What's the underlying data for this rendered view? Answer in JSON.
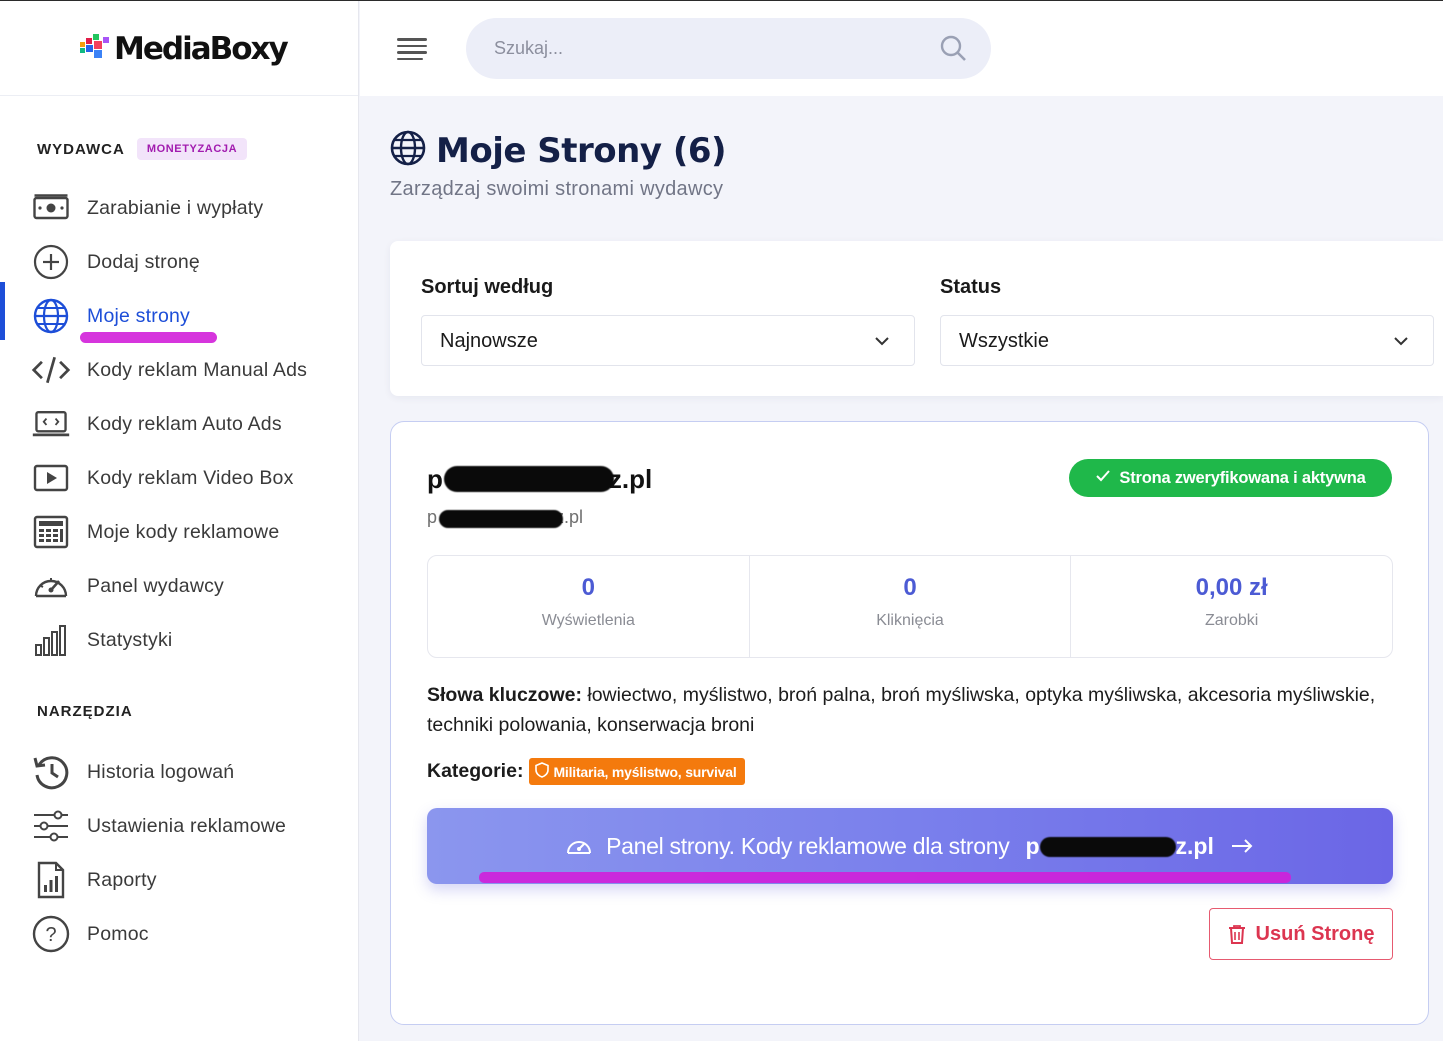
{
  "app": {
    "logo_text": "MediaBoxy"
  },
  "header": {
    "search_placeholder": "Szukaj..."
  },
  "sidebar": {
    "section1_title": "WYDAWCA",
    "section1_badge": "MONETYZACJA",
    "section2_title": "NARZĘDZIA",
    "items": [
      {
        "label": "Zarabianie i wypłaty",
        "icon": "money-icon"
      },
      {
        "label": "Dodaj stronę",
        "icon": "plus-circle-icon"
      },
      {
        "label": "Moje strony",
        "icon": "globe-icon",
        "active": true
      },
      {
        "label": "Kody reklam Manual Ads",
        "icon": "code-icon"
      },
      {
        "label": "Kody reklam Auto Ads",
        "icon": "laptop-code-icon"
      },
      {
        "label": "Kody reklam Video Box",
        "icon": "video-play-icon"
      },
      {
        "label": "Moje kody reklamowe",
        "icon": "calculator-icon"
      },
      {
        "label": "Panel wydawcy",
        "icon": "speedometer-icon"
      },
      {
        "label": "Statystyki",
        "icon": "bar-chart-icon"
      }
    ],
    "tools": [
      {
        "label": "Historia logowań",
        "icon": "history-icon"
      },
      {
        "label": "Ustawienia reklamowe",
        "icon": "sliders-icon"
      },
      {
        "label": "Raporty",
        "icon": "report-icon"
      },
      {
        "label": "Pomoc",
        "icon": "help-icon"
      }
    ]
  },
  "main": {
    "title": "Moje Strony (6)",
    "subtitle": "Zarządzaj swoimi stronami wydawcy",
    "filters": {
      "sort_label": "Sortuj według",
      "sort_value": "Najnowsze",
      "status_label": "Status",
      "status_value": "Wszystkie"
    },
    "site": {
      "title_start": "p",
      "title_end": "z.pl",
      "url_start": "p",
      "url_end": "z.pl",
      "status_badge": "Strona zweryfikowana i aktywna",
      "stats": [
        {
          "value": "0",
          "caption": "Wyświetlenia"
        },
        {
          "value": "0",
          "caption": "Kliknięcia"
        },
        {
          "value": "0,00 zł",
          "caption": "Zarobki"
        }
      ],
      "keywords_label": "Słowa kluczowe:",
      "keywords": "łowiectwo, myślistwo, broń palna, broń myśliwska, optyka myśliwska, akcesoria myśliwskie, techniki polowania, konserwacja broni",
      "categories_label": "Kategorie:",
      "category": "Militaria, myślistwo, survival",
      "panel_button": "Panel strony. Kody reklamowe dla strony",
      "panel_domain_start": "p",
      "panel_domain_end": "z.pl",
      "delete_button": "Usuń Stronę"
    }
  },
  "colors": {
    "accent": "#1d4ed8",
    "verified": "#1fb84a",
    "category": "#f47a0d",
    "danger": "#dc3550"
  }
}
